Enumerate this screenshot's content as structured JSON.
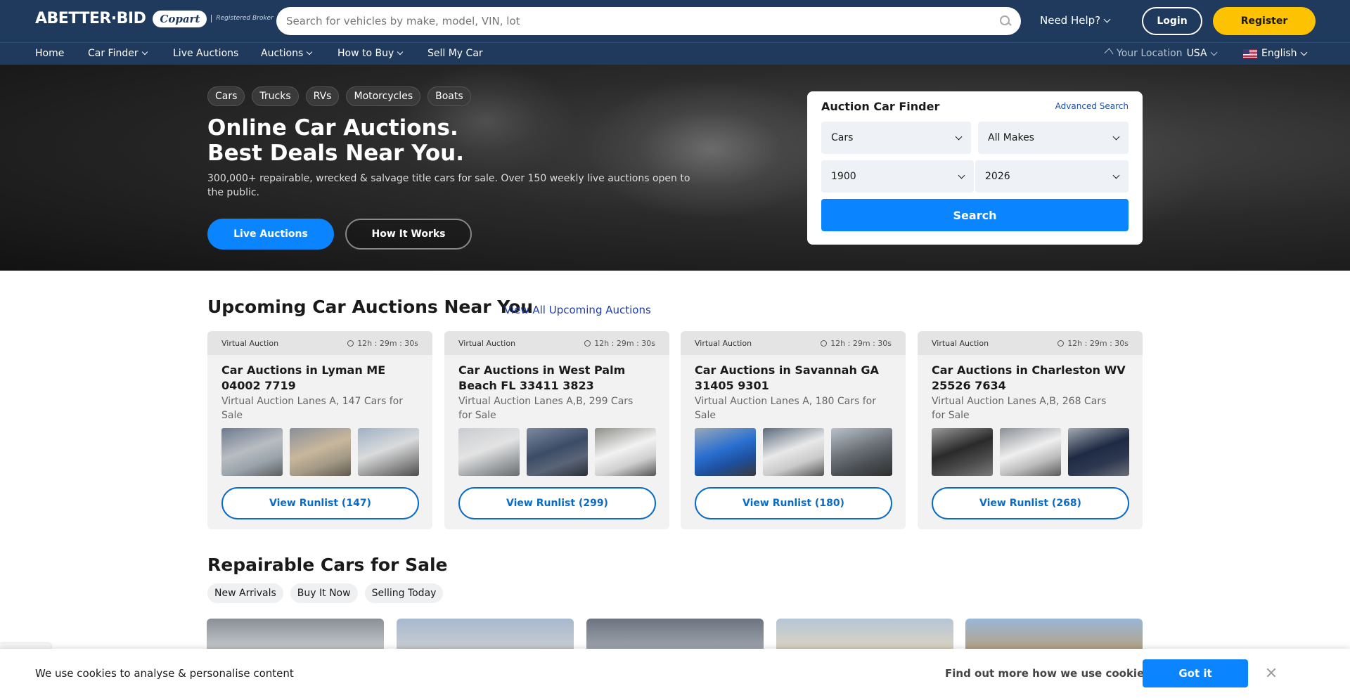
{
  "header": {
    "logo_text": "ABETTER·BID",
    "partner_logo": "Copart",
    "partner_sub": "Registered Broker",
    "search_placeholder": "Search for vehicles by make, model, VIN, lot",
    "need_help": "Need Help?",
    "login": "Login",
    "register": "Register"
  },
  "nav": {
    "items": [
      "Home",
      "Car Finder",
      "Live Auctions",
      "Auctions",
      "How to Buy",
      "Sell My Car"
    ],
    "location_label": "Your Location",
    "location_value": "USA",
    "language": "English"
  },
  "hero": {
    "chips": [
      "Cars",
      "Trucks",
      "RVs",
      "Motorcycles",
      "Boats"
    ],
    "title_line1": "Online Car Auctions.",
    "title_line2": "Best Deals Near You.",
    "subtitle": "300,000+ repairable, wrecked & salvage title cars for sale. Over 150 weekly live auctions open to the public.",
    "btn_live": "Live Auctions",
    "btn_how": "How It Works"
  },
  "finder": {
    "title": "Auction Car Finder",
    "advanced": "Advanced Search",
    "type": "Cars",
    "make": "All Makes",
    "year_from": "1900",
    "year_to": "2026",
    "search": "Search"
  },
  "upcoming": {
    "title": "Upcoming Car Auctions Near You",
    "view_all": "View All Upcoming Auctions",
    "cards": [
      {
        "type": "Virtual Auction",
        "timer": "12h : 29m : 30s",
        "title": "Car Auctions in Lyman ME 04002 7719",
        "sub": "Virtual Auction Lanes A, 147 Cars for Sale",
        "runlist": "View Runlist (147)"
      },
      {
        "type": "Virtual Auction",
        "timer": "12h : 29m : 30s",
        "title": "Car Auctions in West Palm Beach FL 33411 3823",
        "sub": "Virtual Auction Lanes A,B, 299 Cars for Sale",
        "runlist": "View Runlist (299)"
      },
      {
        "type": "Virtual Auction",
        "timer": "12h : 29m : 30s",
        "title": "Car Auctions in Savannah GA 31405 9301",
        "sub": "Virtual Auction Lanes A, 180 Cars for Sale",
        "runlist": "View Runlist (180)"
      },
      {
        "type": "Virtual Auction",
        "timer": "12h : 29m : 30s",
        "title": "Car Auctions in Charleston WV 25526 7634",
        "sub": "Virtual Auction Lanes A,B, 268 Cars for Sale",
        "runlist": "View Runlist (268)"
      }
    ]
  },
  "repairable": {
    "title": "Repairable Cars for Sale",
    "filters": [
      "New Arrivals",
      "Buy It Now",
      "Selling Today"
    ]
  },
  "cookie": {
    "text": "We use cookies to analyse & personalise content",
    "more": "Find out more how we use cookies",
    "got_it": "Got it"
  },
  "colors": {
    "header_bg": "#1f3a5c",
    "accent_blue": "#0a84ff",
    "register_yellow": "#fdc202"
  }
}
